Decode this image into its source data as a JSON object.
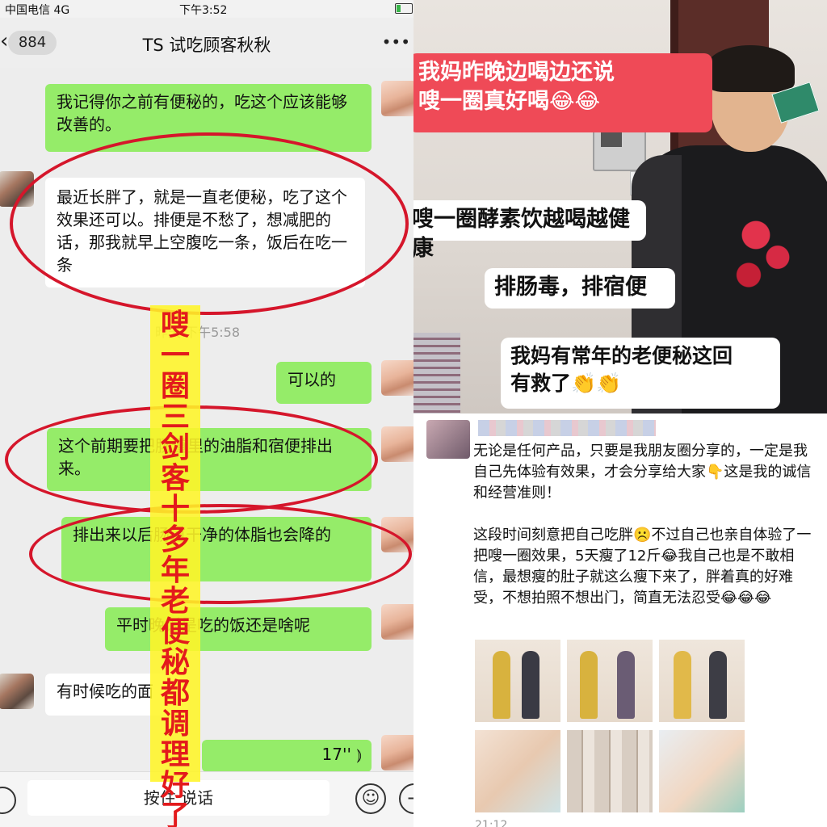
{
  "chat": {
    "status": {
      "carrier": "中国电信  4G",
      "time": "下午3:52"
    },
    "nav": {
      "back_icon": "chevron-left-icon",
      "unread_count": "884",
      "title": "TS 试吃顾客秋秋",
      "more_icon": "ellipsis-icon"
    },
    "messages": [
      {
        "from": "me",
        "text": "我记得你之前有便秘的，吃这个应该能够改善的。"
      },
      {
        "from": "other",
        "text": "最近长胖了，就是一直老便秘，吃了这个效果还可以。排便是不愁了，想减肥的话，那我就早上空腹吃一条，饭后在吃一条"
      },
      {
        "from": "me",
        "text": "可以的"
      },
      {
        "from": "me",
        "text": "这个前期要把肠道里的油脂和宿便排出来。"
      },
      {
        "from": "me",
        "text": "排出来以后肠道干净的体脂也会降的"
      },
      {
        "from": "me",
        "text": "平时晚饭是吃的饭还是啥呢"
      },
      {
        "from": "other",
        "text": "有时候吃的面"
      },
      {
        "from": "me",
        "voice_duration": "17''"
      }
    ],
    "timestamp": "昨天 下午5:58",
    "input": {
      "hold_to_talk": "按住 说话",
      "emoji_icon": "smiley-icon",
      "plus_icon": "plus-icon",
      "voice_icon": "voice-icon"
    },
    "overlay_vertical_text": "嗖一圈三剑客十多年老便秘都调理好了",
    "highlight_color": "#d5162b"
  },
  "photo": {
    "captions": [
      {
        "text_line1": "我妈昨晚边喝边还说",
        "text_line2": "嗖一圈真好喝😂😂"
      },
      {
        "text": "嗖一圈酵素饮越喝越健康"
      },
      {
        "text": "排肠毒，排宿便"
      },
      {
        "text_line1": "我妈有常年的老便秘这回",
        "text_line2": "有救了👏👏"
      }
    ]
  },
  "post": {
    "text": "无论是任何产品，只要是我朋友圈分享的，一定是我自己先体验有效果，才会分享给大家👇这是我的诚信和经营准则！\n\n这段时间刻意把自己吃胖☹️不过自己也亲自体验了一把嗖一圈效果，5天瘦了12斤😂我自己也是不敢相信，最想瘦的肚子就这么瘦下来了，胖着真的好难受，不想拍照不想出门，简直无法忍受😂😂😂",
    "time": "21:12"
  }
}
